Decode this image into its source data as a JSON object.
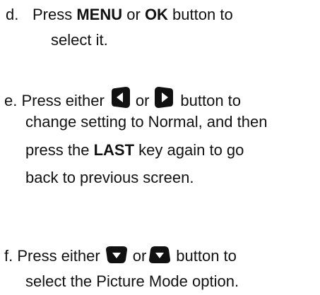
{
  "steps": {
    "d": {
      "marker": "d.",
      "line1_prefix": "Press ",
      "menu_key": "MENU",
      "or_word": " or ",
      "ok_key": "OK",
      "line1_suffix": " button to",
      "line2": "select it."
    },
    "e": {
      "prefix": "e. Press either",
      "or_word": "or",
      "suffix": "button to",
      "line2": "change setting to Normal, and then",
      "line3_prefix": "press the ",
      "last_key": "LAST",
      "line3_suffix": " key again to go",
      "line4": "back to previous screen.",
      "icon_left": "left-arrow-button-icon",
      "icon_right": "right-arrow-button-icon"
    },
    "f": {
      "prefix": "f. Press either",
      "or_word": "or",
      "suffix": "button to",
      "line2": "select the Picture Mode option.",
      "icon_up": "up-arrow-button-icon",
      "icon_down": "down-arrow-button-icon"
    }
  }
}
